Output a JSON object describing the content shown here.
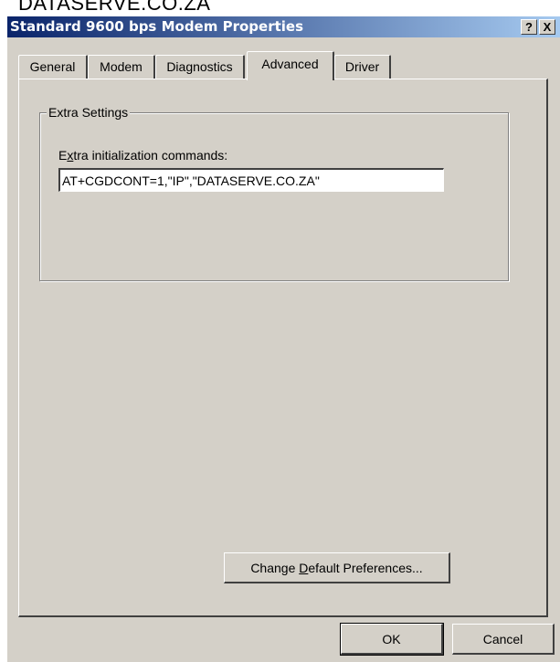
{
  "background_caption": "DATASERVE.CO.ZA",
  "window": {
    "title": "Standard  9600 bps Modem Properties",
    "help_label": "?",
    "close_label": "X"
  },
  "tabs": [
    {
      "label": "General",
      "active": false
    },
    {
      "label": "Modem",
      "active": false
    },
    {
      "label": "Diagnostics",
      "active": false
    },
    {
      "label": "Advanced",
      "active": true
    },
    {
      "label": "Driver",
      "active": false
    }
  ],
  "extra_settings": {
    "group_label": "Extra Settings",
    "field_label_prefix": "E",
    "field_label_mnemonic": "x",
    "field_label_rest": "tra initialization commands:",
    "value": "AT+CGDCONT=1,\"IP\",\"DATASERVE.CO.ZA\""
  },
  "change_defaults_button": {
    "prefix": "Change ",
    "mnemonic": "D",
    "rest": "efault Preferences..."
  },
  "footer": {
    "ok_label": "OK",
    "cancel_label": "Cancel"
  },
  "colors": {
    "dialog_face": "#d4d0c8",
    "titlebar_start": "#0a246a",
    "titlebar_end": "#a6caf0"
  }
}
